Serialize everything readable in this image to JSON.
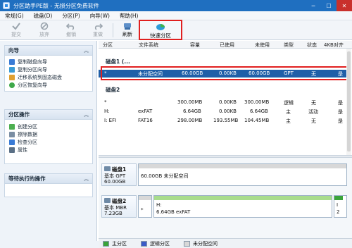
{
  "app": {
    "title": "分区助手PE版 - 无损分区免费软件"
  },
  "menu": [
    "常规(G)",
    "磁盘(D)",
    "分区(P)",
    "向导(W)",
    "帮助(H)"
  ],
  "toolbar": {
    "commit": "提交",
    "discard": "放弃",
    "undo": "撤销",
    "redo": "重做",
    "refresh": "刷新",
    "quick_partition": "快速分区"
  },
  "wizard_panel": {
    "title": "向导",
    "items": [
      "复制磁盘向导",
      "复制分区向导",
      "迁移系统到固态磁盘",
      "分区恢复向导"
    ]
  },
  "partition_ops_panel": {
    "title": "分区操作",
    "items": [
      "创建分区",
      "擦除数据",
      "检查分区",
      "属性"
    ]
  },
  "pending_panel": {
    "title": "等待执行的操作"
  },
  "columns": [
    "分区",
    "文件系统",
    "容量",
    "已使用",
    "未使用",
    "类型",
    "状态",
    "4KB对齐"
  ],
  "disk1": {
    "label": "磁盘1 (...",
    "rows": [
      {
        "part": "*",
        "fs": "未分配空间",
        "cap": "60.00GB",
        "used": "0.00KB",
        "free": "60.00GB",
        "type": "GPT",
        "status": "无",
        "align": "是"
      }
    ]
  },
  "disk2": {
    "label": "磁盘2",
    "rows": [
      {
        "part": "*",
        "fs": "",
        "cap": "300.00MB",
        "used": "0.00KB",
        "free": "300.00MB",
        "type": "逻辑",
        "status": "无",
        "align": "是"
      },
      {
        "part": "H:",
        "fs": "exFAT",
        "cap": "6.64GB",
        "used": "0.00KB",
        "free": "6.64GB",
        "type": "主",
        "status": "活动",
        "align": "是"
      },
      {
        "part": "I: EFI",
        "fs": "FAT16",
        "cap": "298.00MB",
        "used": "193.55MB",
        "free": "104.45MB",
        "type": "主",
        "status": "无",
        "align": "是"
      }
    ]
  },
  "map": {
    "disk1": {
      "name": "磁盘1",
      "line2": "基本 GPT",
      "line3": "60.00GB",
      "part_label": "60.00GB 未分配空间"
    },
    "disk2": {
      "name": "磁盘2",
      "line2": "基本 MBR",
      "line3": "7.23GB",
      "p1_label": "*",
      "p2_t1": "H:",
      "p2_t2": "6.64GB exFAT",
      "p3_t1": "I",
      "p3_t2": "2"
    }
  },
  "legend": [
    "主分区",
    "逻辑分区",
    "未分配空间"
  ],
  "colors": {
    "primary": "#3aa43a",
    "logical": "#3a5bc7",
    "unallocated": "#d8d8d8",
    "accent": "#1f6fc0",
    "highlight": "#e02020"
  }
}
